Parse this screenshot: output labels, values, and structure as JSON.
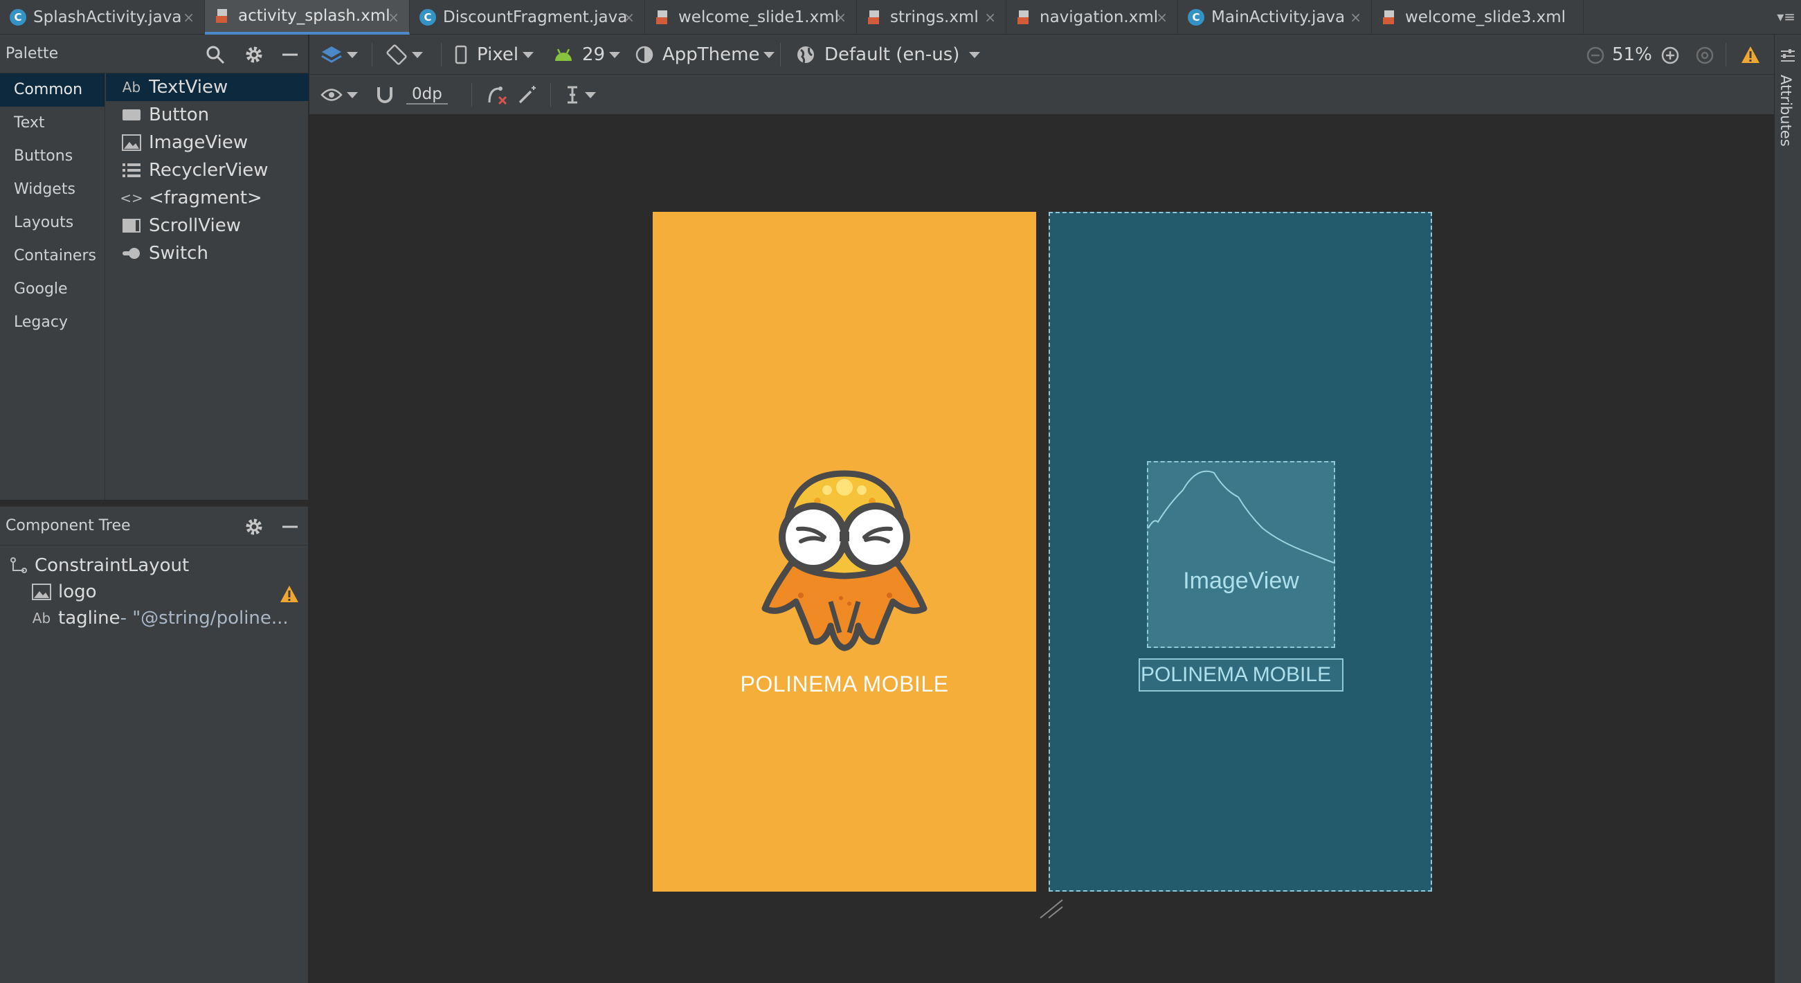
{
  "tabs": [
    {
      "label": "SplashActivity.java",
      "kind": "java",
      "active": false
    },
    {
      "label": "activity_splash.xml",
      "kind": "xml",
      "active": true
    },
    {
      "label": "DiscountFragment.java",
      "kind": "java",
      "active": false
    },
    {
      "label": "welcome_slide1.xml",
      "kind": "xml",
      "active": false
    },
    {
      "label": "strings.xml",
      "kind": "xml",
      "active": false
    },
    {
      "label": "navigation.xml",
      "kind": "xml",
      "active": false
    },
    {
      "label": "MainActivity.java",
      "kind": "java",
      "active": false
    },
    {
      "label": "welcome_slide3.xml",
      "kind": "xml",
      "active": false
    }
  ],
  "palette": {
    "title": "Palette",
    "categories": [
      "Common",
      "Text",
      "Buttons",
      "Widgets",
      "Layouts",
      "Containers",
      "Google",
      "Legacy"
    ],
    "selected_category": "Common",
    "items": [
      {
        "label": "TextView",
        "icon": "Ab"
      },
      {
        "label": "Button",
        "icon": "button-icon"
      },
      {
        "label": "ImageView",
        "icon": "image-icon"
      },
      {
        "label": "RecyclerView",
        "icon": "list-icon"
      },
      {
        "label": "<fragment>",
        "icon": "code-icon"
      },
      {
        "label": "ScrollView",
        "icon": "scroll-icon"
      },
      {
        "label": "Switch",
        "icon": "switch-icon"
      }
    ],
    "selected_item": "TextView"
  },
  "component_tree": {
    "title": "Component Tree",
    "root": "ConstraintLayout",
    "children": [
      {
        "label": "logo",
        "icon": "image-icon",
        "warning": true
      },
      {
        "label": "tagline",
        "detail": "- \"@string/poline...",
        "icon": "Ab",
        "warning": false
      }
    ]
  },
  "toolbar": {
    "device": "Pixel",
    "api_level": "29",
    "theme": "AppTheme",
    "locale": "Default (en-us)",
    "zoom": "51%",
    "margin": "0dp"
  },
  "design": {
    "background_color": "#f5ae3a",
    "tagline": "POLINEMA MOBILE"
  },
  "blueprint": {
    "background_color": "#235b6d",
    "image_label": "ImageView",
    "tagline": "POLINEMA MOBILE"
  },
  "right_panel": {
    "label": "Attributes"
  }
}
